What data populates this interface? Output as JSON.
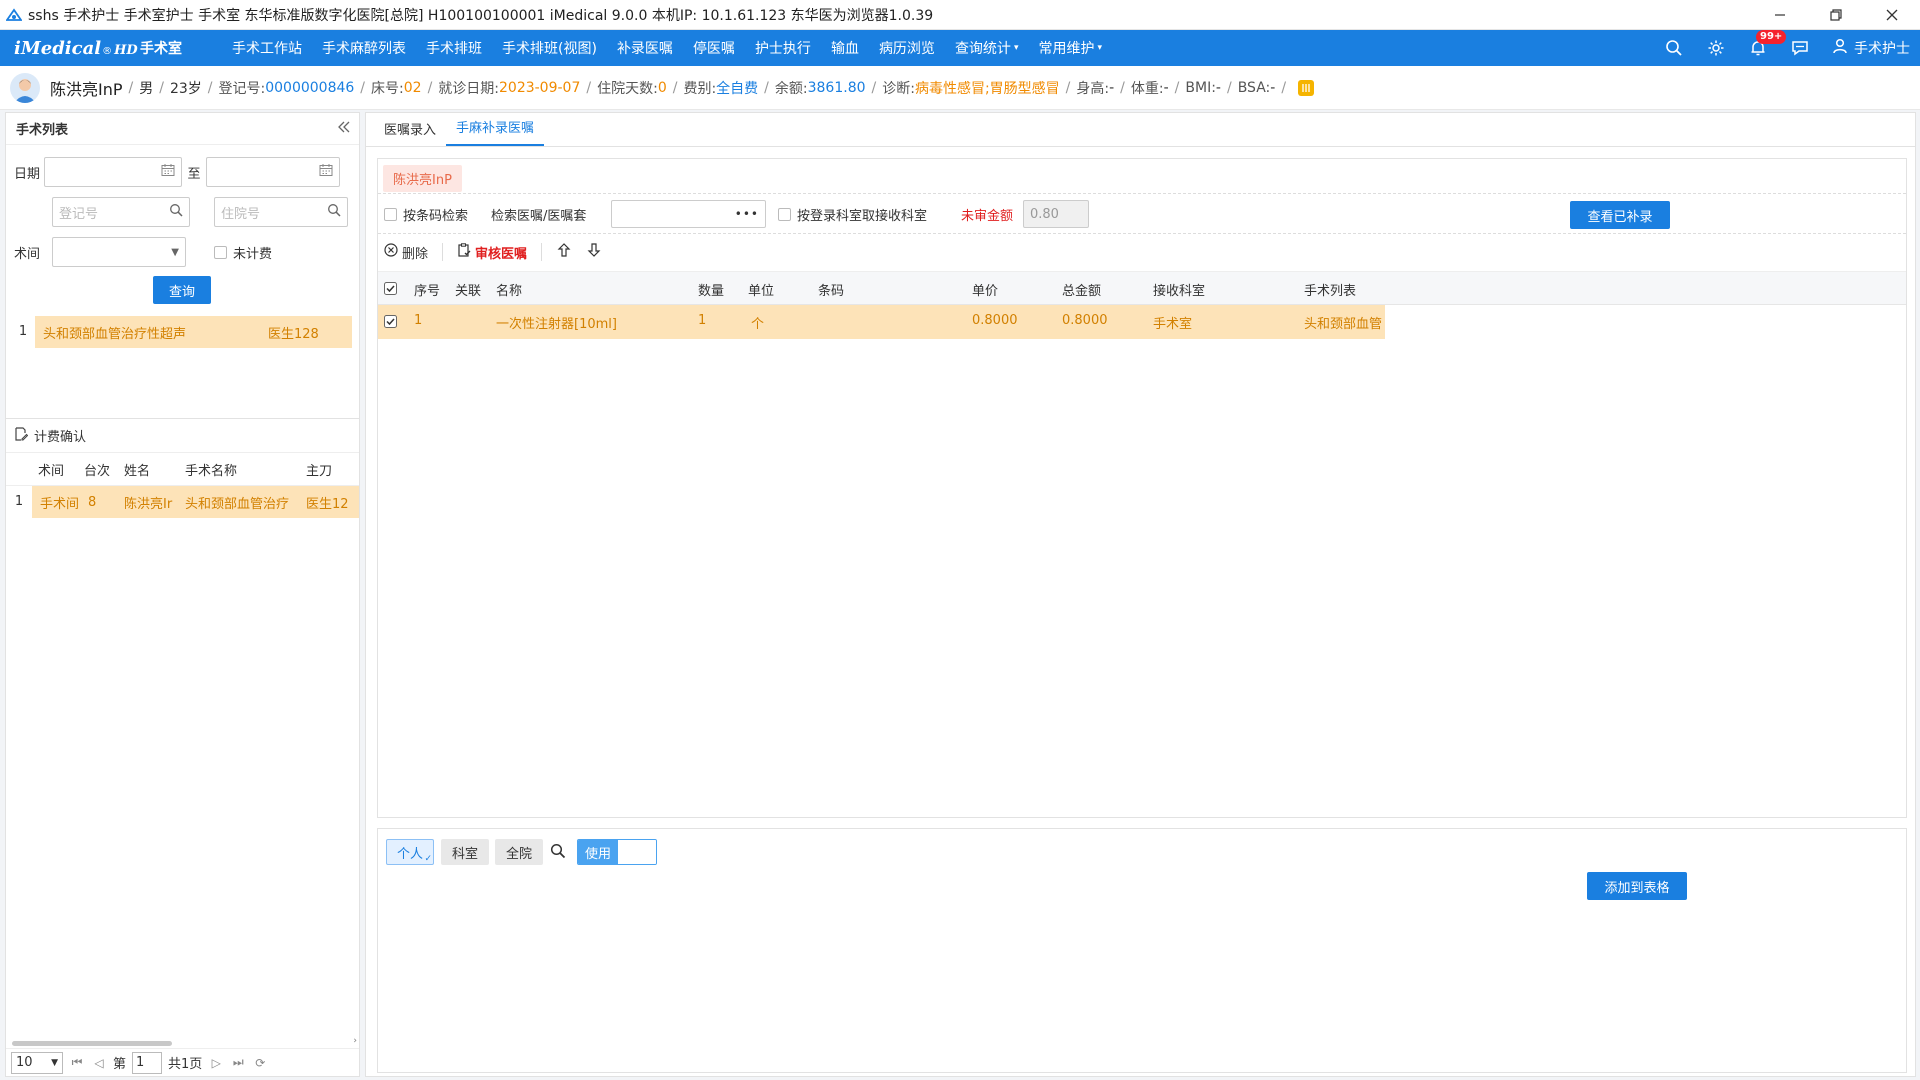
{
  "window": {
    "title": "sshs 手术护士 手术室护士 手术室 东华标准版数字化医院[总院] H100100100001 iMedical 9.0.0 本机IP: 10.1.61.123  东华医为浏览器1.0.39",
    "controls": [
      "minimize",
      "restore",
      "close"
    ]
  },
  "nav": {
    "brand_main": "iMedical",
    "brand_reg": "®",
    "brand_hd": "HD",
    "dept": "手术室",
    "items": [
      {
        "label": "手术工作站"
      },
      {
        "label": "手术麻醉列表"
      },
      {
        "label": "手术排班"
      },
      {
        "label": "手术排班(视图)"
      },
      {
        "label": "补录医嘱"
      },
      {
        "label": "停医嘱"
      },
      {
        "label": "护士执行"
      },
      {
        "label": "输血"
      },
      {
        "label": "病历浏览"
      },
      {
        "label": "查询统计",
        "dropdown": true
      },
      {
        "label": "常用维护",
        "dropdown": true
      }
    ],
    "notif_badge": "99+",
    "user": "手术护士"
  },
  "patient": {
    "name": "陈洪亮InP",
    "gender": "男",
    "age": "23岁",
    "reg_label": "登记号:",
    "reg_no": "0000000846",
    "bed_label": "床号:",
    "bed": "02",
    "visit_label": "就诊日期:",
    "visit_date": "2023-09-07",
    "days_label": "住院天数:",
    "days": "0",
    "fee_label": "费别:",
    "fee_type": "全自费",
    "balance_label": "余额:",
    "balance": "3861.80",
    "diag_label": "诊断:",
    "diagnosis": "病毒性感冒;胃肠型感冒",
    "height_label": "身高:",
    "height": "-",
    "weight_label": "体重:",
    "weight": "-",
    "bmi_label": "BMI:",
    "bmi": "-",
    "bsa_label": "BSA:",
    "bsa": "-"
  },
  "left": {
    "title": "手术列表",
    "date_label": "日期",
    "to_label": "至",
    "reg_placeholder": "登记号",
    "inpatient_placeholder": "住院号",
    "room_label": "术间",
    "unbilled_label": "未计费",
    "query_btn": "查询",
    "operations": [
      {
        "idx": "1",
        "name": "头和颈部血管治疗性超声",
        "doctor": "医生128"
      }
    ],
    "charge_title": "计费确认",
    "charge_headers": [
      "术间",
      "台次",
      "姓名",
      "手术名称",
      "主刀"
    ],
    "charge_rows": [
      {
        "idx": "1",
        "room": "手术间",
        "seq": "8",
        "name": "陈洪亮Ir",
        "op": "头和颈部血管治疗",
        "surgeon": "医生12"
      }
    ],
    "pager": {
      "size": "10",
      "page_prefix": "第",
      "page": "1",
      "total": "共1页"
    }
  },
  "right": {
    "tabs": [
      {
        "label": "医嘱录入",
        "active": false
      },
      {
        "label": "手麻补录医嘱",
        "active": true
      }
    ],
    "patient_tag": "陈洪亮InP",
    "filters": {
      "barcode_label": "按条码检索",
      "search_label": "检索医嘱/医嘱套",
      "search_more": "•••",
      "dept_label": "按登录科室取接收科室",
      "unaudited_label": "未审金额",
      "unaudited_value": "0.80",
      "view_btn": "查看已补录"
    },
    "toolbar": {
      "delete": "删除",
      "audit": "审核医嘱"
    },
    "grid": {
      "headers": [
        "序号",
        "关联",
        "名称",
        "数量",
        "单位",
        "条码",
        "单价",
        "总金额",
        "接收科室",
        "手术列表"
      ],
      "rows": [
        {
          "seq": "1",
          "link": "",
          "name": "一次性注射器[10ml]",
          "qty": "1",
          "unit": "个",
          "barcode": "",
          "price": "0.8000",
          "total": "0.8000",
          "dept": "手术室",
          "oplist": "头和颈部血管"
        }
      ]
    },
    "bottom": {
      "seg_personal": "个人",
      "seg_dept": "科室",
      "seg_hospital": "全院",
      "toggle_on": "使用",
      "add_btn": "添加到表格"
    }
  }
}
